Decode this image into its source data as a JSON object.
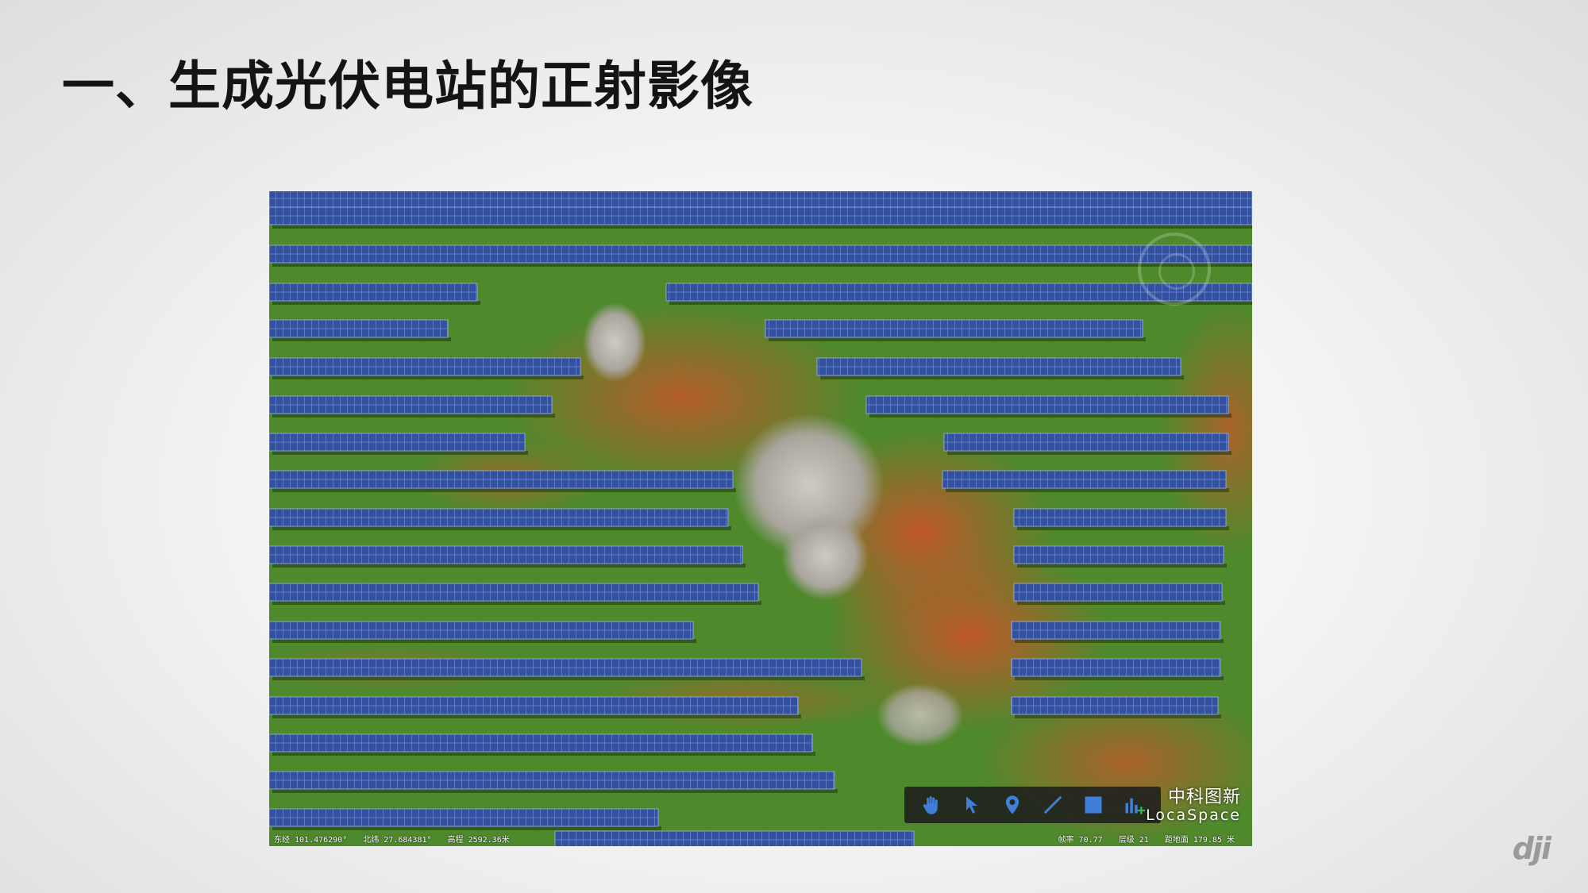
{
  "slide": {
    "title": "一、生成光伏电站的正射影像",
    "logo_text": "dji"
  },
  "map": {
    "watermark_cn": "中科图新",
    "watermark_en": "LocaSpace",
    "status_left": [
      "东经 101.476290°",
      "北纬 27.684381°",
      "高程 2592.36米"
    ],
    "status_right": [
      "帧率 70.77",
      "层级 21",
      "距地面 179.85 米"
    ],
    "toolbar_icons": [
      "hand-pan-icon",
      "pointer-select-icon",
      "location-pin-icon",
      "measure-line-icon",
      "area-square-icon",
      "chart-add-icon"
    ]
  },
  "colors": {
    "panel_blue": "#2f4f9e",
    "grass_green": "#4f8a2e",
    "soil_red": "#b8562a",
    "rock_gray": "#b8b4ae",
    "title_text": "#141414",
    "logo_gray": "#9a9a9a"
  }
}
